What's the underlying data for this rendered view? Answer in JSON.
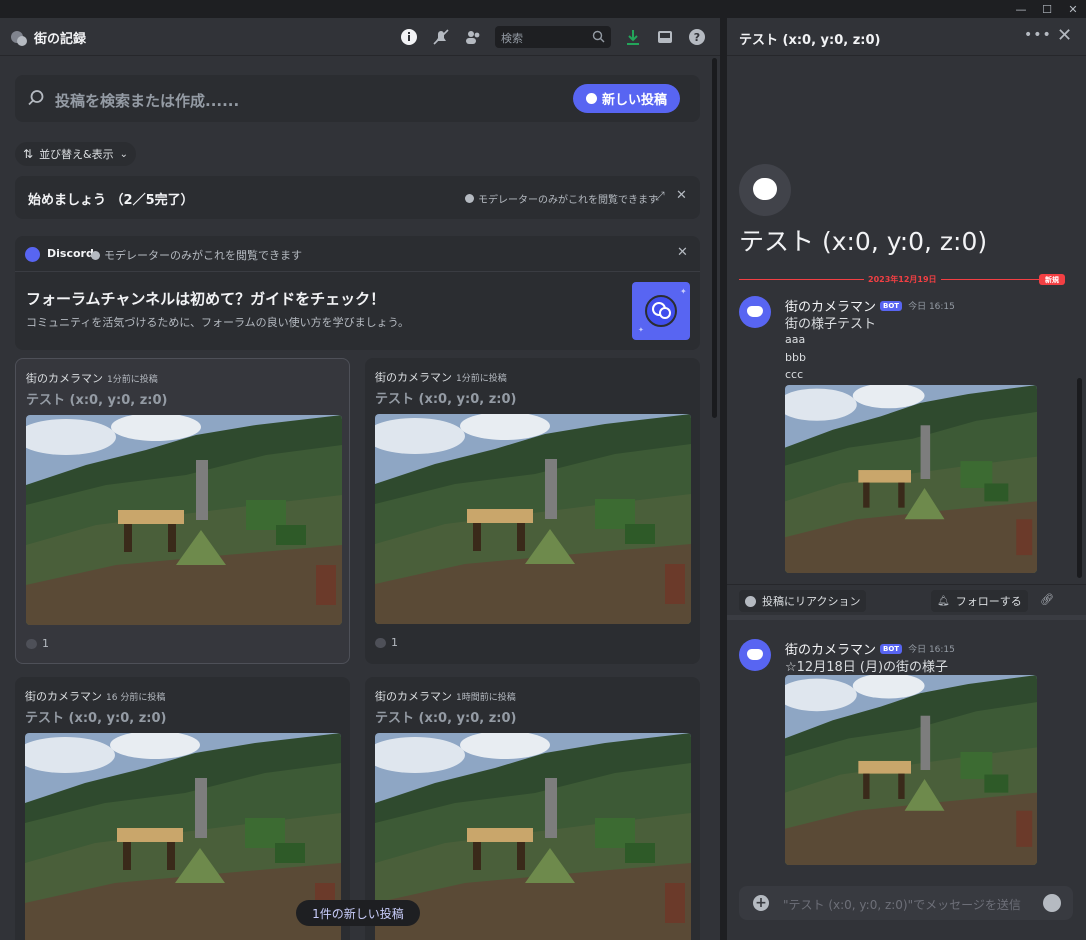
{
  "window": {
    "minimize": "—",
    "maximize": "☐",
    "close": "✕"
  },
  "channel": {
    "name": "街の記録"
  },
  "header": {
    "search_placeholder": "検索"
  },
  "forum": {
    "search_placeholder": "投稿を検索または作成......",
    "new_post_label": "新しい投稿",
    "sort_label": "並び替え&表示"
  },
  "getting_started": {
    "title": "始めましょう （2／5完了）",
    "mod_note": "モデレーターのみがこれを閲覧できます"
  },
  "guide": {
    "brand": "Discord",
    "mod_note": "モデレーターのみがこれを閲覧できます",
    "title": "フォーラムチャンネルは初めて？ガイドをチェック！",
    "subtitle": "コミュニティを活気づけるために、フォーラムの良い使い方を学びましょう。"
  },
  "posts": [
    {
      "author": "街のカメラマン",
      "time": "1分前に投稿",
      "title": "テスト (x:0, y:0, z:0)",
      "count": "1"
    },
    {
      "author": "街のカメラマン",
      "time": "1分前に投稿",
      "title": "テスト (x:0, y:0, z:0)",
      "count": "1"
    },
    {
      "author": "街のカメラマン",
      "time": "16 分前に投稿",
      "title": "テスト (x:0, y:0, z:0)",
      "count": ""
    },
    {
      "author": "街のカメラマン",
      "time": "1時間前に投稿",
      "title": "テスト (x:0, y:0, z:0)",
      "count": ""
    }
  ],
  "new_posts_pill": "1件の新しい投稿",
  "thread": {
    "header_title": "テスト (x:0, y:0, z:0)",
    "big_title": "テスト (x:0, y:0, z:0)",
    "date_divider": "2023年12月19日",
    "new_badge": "新規",
    "messages": [
      {
        "author": "街のカメラマン",
        "bot": "BOT",
        "time": "今日 16:15",
        "line1": "街の様子テスト",
        "lines": [
          "aaa",
          "bbb",
          "ccc"
        ]
      },
      {
        "author": "街のカメラマン",
        "bot": "BOT",
        "time": "今日 16:15",
        "line1": "☆12月18日 (月)の街の様子",
        "lines": []
      }
    ],
    "react_label": "投稿にリアクション",
    "follow_label": "フォローする",
    "composer_placeholder": "\"テスト (x:0, y:0, z:0)\"でメッセージを送信"
  },
  "colors": {
    "accent": "#5865f2",
    "new_red": "#f23f43"
  }
}
